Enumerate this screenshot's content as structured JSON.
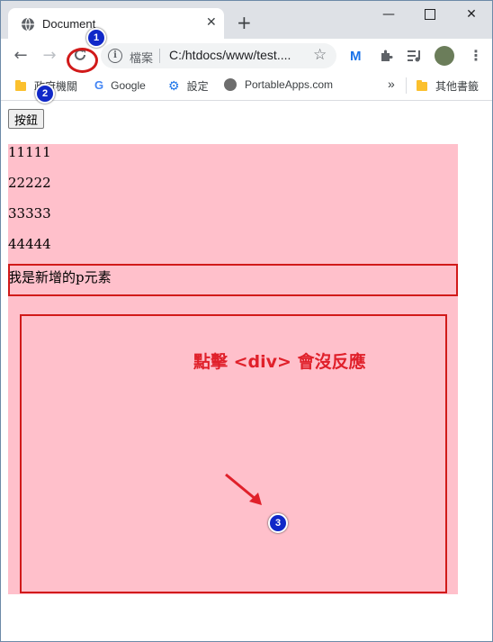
{
  "browser": {
    "tab_title": "Document",
    "scheme_label": "檔案",
    "url": "C:/htdocs/www/test....",
    "extensions": [
      "M"
    ]
  },
  "bookmarks": [
    {
      "label": "政府機關",
      "icon": "folder-icon"
    },
    {
      "label": "Google",
      "icon": "google-icon"
    },
    {
      "label": "設定",
      "icon": "gear-icon"
    },
    {
      "label": "PortableApps.com",
      "icon": "portableapps-icon"
    }
  ],
  "bookmarks_overflow": "»",
  "other_bookmarks": "其他書籤",
  "page": {
    "button_label": "按鈕",
    "paragraphs": [
      "11111",
      "22222",
      "33333",
      "44444"
    ],
    "new_paragraph": "我是新增的p元素",
    "div_color": "#ffc0cb"
  },
  "annotations": {
    "marker_1": "1",
    "marker_2": "2",
    "marker_3": "3",
    "note": "點擊 <div> 會沒反應",
    "highlight_color": "#d11a1a"
  }
}
